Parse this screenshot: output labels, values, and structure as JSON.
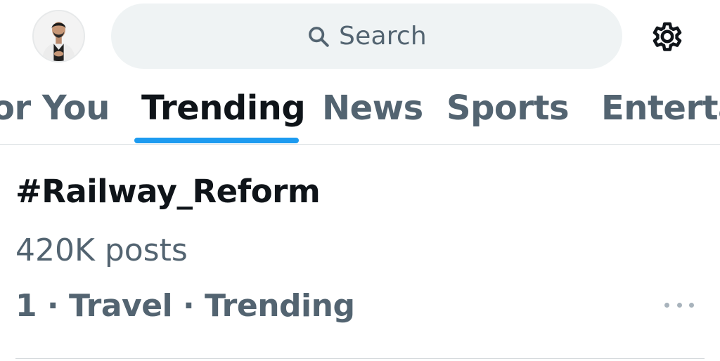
{
  "header": {
    "search_placeholder": "Search",
    "avatar_icon": "profile-avatar",
    "settings_icon": "gear-icon"
  },
  "tabs": [
    {
      "label": "For You",
      "visible_label": "or You",
      "active": false
    },
    {
      "label": "Trending",
      "active": true
    },
    {
      "label": "News",
      "active": false
    },
    {
      "label": "Sports",
      "active": false
    },
    {
      "label": "Entertainment",
      "visible_label": "Enterta",
      "active": false
    }
  ],
  "trend": {
    "title": "#Railway_Reform",
    "posts": "420K posts",
    "context": "1 · Travel · Trending",
    "more_icon": "more-dots-icon"
  },
  "colors": {
    "accent": "#1d9bf0",
    "primary_text": "#0f1419",
    "secondary_text": "#536471",
    "search_bg": "#eff3f4"
  }
}
